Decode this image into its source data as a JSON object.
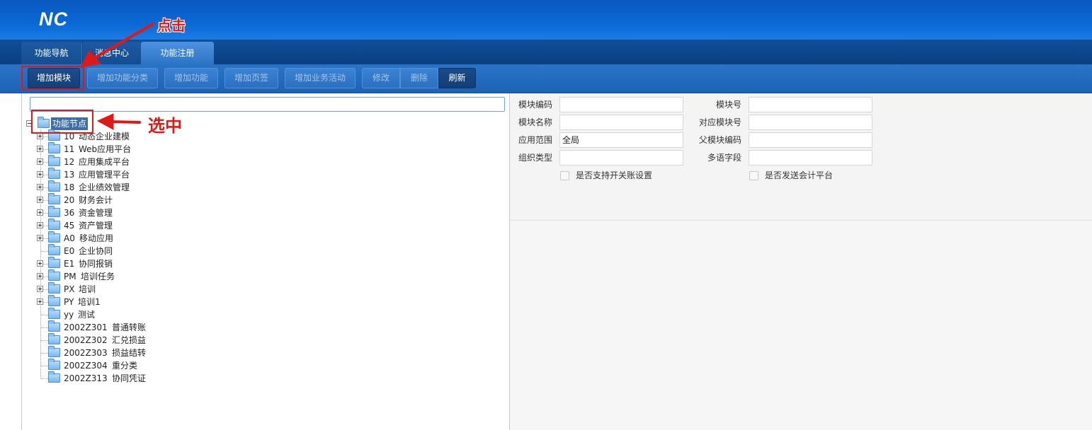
{
  "app": {
    "logo": "NC"
  },
  "tabs": [
    {
      "label": "功能导航"
    },
    {
      "label": "消息中心"
    },
    {
      "label": "功能注册"
    }
  ],
  "toolbar": {
    "add_module": "增加模块",
    "add_func_category": "增加功能分类",
    "add_func": "增加功能",
    "add_page": "增加页签",
    "add_biz": "增加业务活动",
    "edit": "修改",
    "delete": "删除",
    "refresh": "刷新"
  },
  "search": {
    "value": ""
  },
  "tree": {
    "root": "功能节点",
    "items": [
      {
        "code": "10",
        "name": "动态企业建模",
        "expandable": true
      },
      {
        "code": "11",
        "name": "Web应用平台",
        "expandable": true
      },
      {
        "code": "12",
        "name": "应用集成平台",
        "expandable": true
      },
      {
        "code": "13",
        "name": "应用管理平台",
        "expandable": true
      },
      {
        "code": "18",
        "name": "企业绩效管理",
        "expandable": true
      },
      {
        "code": "20",
        "name": "财务会计",
        "expandable": true
      },
      {
        "code": "36",
        "name": "资金管理",
        "expandable": true
      },
      {
        "code": "45",
        "name": "资产管理",
        "expandable": true
      },
      {
        "code": "A0",
        "name": "移动应用",
        "expandable": true
      },
      {
        "code": "E0",
        "name": "企业协同",
        "expandable": false
      },
      {
        "code": "E1",
        "name": "协同报销",
        "expandable": true
      },
      {
        "code": "PM",
        "name": "培训任务",
        "expandable": true
      },
      {
        "code": "PX",
        "name": "培训",
        "expandable": true
      },
      {
        "code": "PY",
        "name": "培训1",
        "expandable": true
      },
      {
        "code": "yy",
        "name": "测试",
        "expandable": false
      },
      {
        "code": "2002Z301",
        "name": "普通转账",
        "expandable": false
      },
      {
        "code": "2002Z302",
        "name": "汇兑损益",
        "expandable": false
      },
      {
        "code": "2002Z303",
        "name": "损益结转",
        "expandable": false
      },
      {
        "code": "2002Z304",
        "name": "重分类",
        "expandable": false
      },
      {
        "code": "2002Z313",
        "name": "协同凭证",
        "expandable": false
      }
    ]
  },
  "form": {
    "module_code": {
      "label": "模块编码",
      "value": ""
    },
    "module_no": {
      "label": "模块号",
      "value": ""
    },
    "module_name": {
      "label": "模块名称",
      "value": ""
    },
    "mapped_module_no": {
      "label": "对应模块号",
      "value": ""
    },
    "scope": {
      "label": "应用范围",
      "value": "全局"
    },
    "parent_code": {
      "label": "父模块编码",
      "value": ""
    },
    "org_type": {
      "label": "组织类型",
      "value": ""
    },
    "multilang": {
      "label": "多语字段",
      "value": ""
    },
    "support_period": {
      "label": "是否支持开关账设置",
      "checked": false
    },
    "send_accounting": {
      "label": "是否发送会计平台",
      "checked": false
    }
  },
  "annotations": {
    "click": "点击",
    "select": "选中",
    "color": "#e01818"
  }
}
